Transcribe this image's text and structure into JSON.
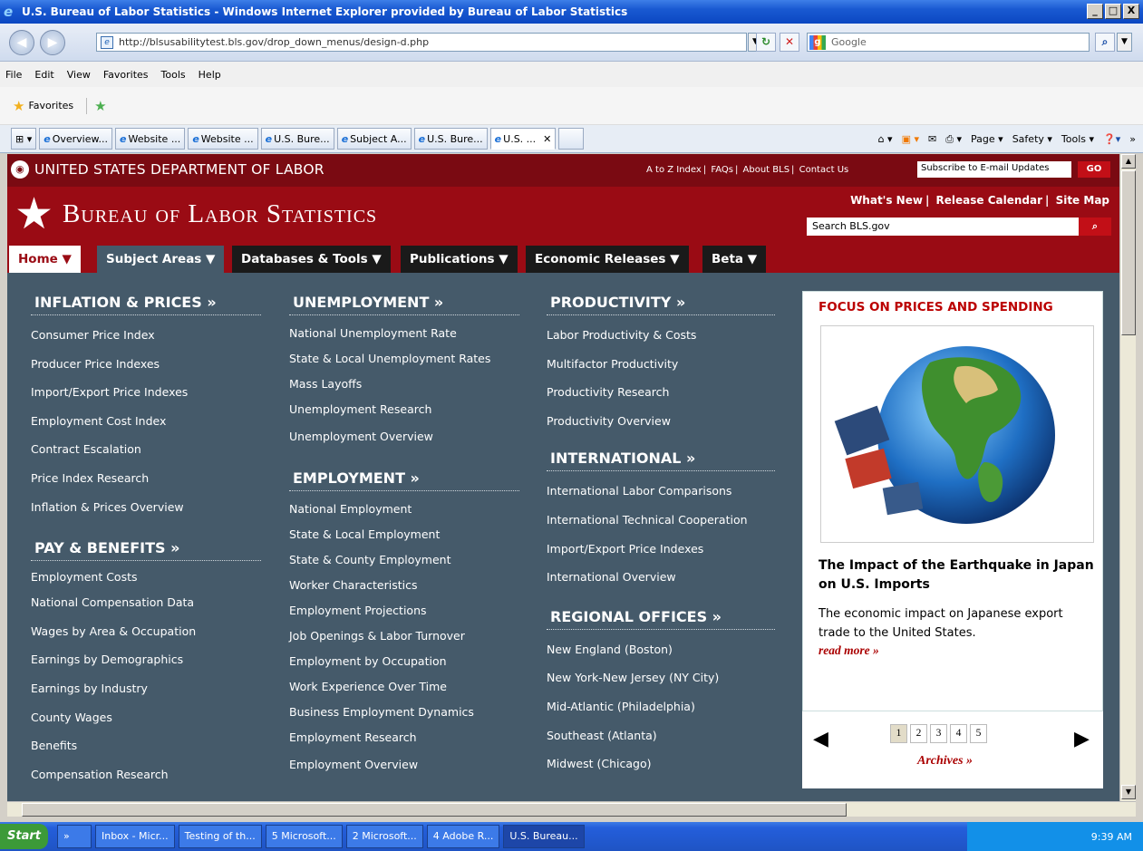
{
  "window": {
    "title": "U.S. Bureau of Labor Statistics - Windows Internet Explorer provided by Bureau of Labor Statistics",
    "min": "_",
    "max": "□",
    "close": "X"
  },
  "address": {
    "url": "http://blsusabilitytest.bls.gov/drop_down_menus/design-d.php",
    "search_placeholder": "Google"
  },
  "menu": [
    "File",
    "Edit",
    "View",
    "Favorites",
    "Tools",
    "Help"
  ],
  "favorites": {
    "label": "Favorites"
  },
  "tabs": [
    "Overview...",
    "Website ...",
    "Website ...",
    "U.S. Bure...",
    "Subject A...",
    "U.S. Bure...",
    "U.S. ..."
  ],
  "commands": {
    "page": "Page ▾",
    "safety": "Safety ▾",
    "tools": "Tools ▾"
  },
  "site": {
    "dol": "UNITED STATES DEPARTMENT OF LABOR",
    "toplinks": [
      "A to Z Index",
      "FAQs",
      "About BLS",
      "Contact Us"
    ],
    "subscribe": "Subscribe to E-mail Updates",
    "go": "GO",
    "bls": "Bureau of Labor Statistics",
    "bls_links": [
      "What's New",
      "Release Calendar",
      "Site Map"
    ],
    "search_value": "Search BLS.gov",
    "search_btn": "Q"
  },
  "nav": [
    {
      "label": "Home ▼"
    },
    {
      "label": "Subject Areas ▼"
    },
    {
      "label": "Databases & Tools ▼"
    },
    {
      "label": "Publications ▼"
    },
    {
      "label": "Economic Releases ▼"
    },
    {
      "label": "Beta ▼"
    }
  ],
  "col1": {
    "s1": "INFLATION & PRICES »",
    "l1": [
      "Consumer Price Index",
      "Producer Price Indexes",
      "Import/Export Price Indexes",
      "Employment Cost Index",
      "Contract Escalation",
      "Price Index Research",
      "Inflation & Prices Overview"
    ],
    "s2": "PAY & BENEFITS »",
    "l2": [
      "Employment Costs",
      "National Compensation Data",
      "Wages by Area & Occupation",
      "Earnings by Demographics",
      "Earnings by Industry",
      "County Wages",
      "Benefits",
      "Compensation Research"
    ]
  },
  "col2": {
    "s1": "UNEMPLOYMENT »",
    "l1": [
      "National Unemployment Rate",
      "State & Local Unemployment Rates",
      "Mass Layoffs",
      "Unemployment Research",
      "Unemployment Overview"
    ],
    "s2": "EMPLOYMENT »",
    "l2": [
      "National Employment",
      "State & Local Employment",
      "State & County Employment",
      "Worker Characteristics",
      "Employment Projections",
      "Job Openings & Labor Turnover",
      "Employment by Occupation",
      "Work Experience Over Time",
      "Business Employment Dynamics",
      "Employment Research",
      "Employment Overview"
    ]
  },
  "col3": {
    "s1": "PRODUCTIVITY »",
    "l1": [
      "Labor Productivity & Costs",
      "Multifactor Productivity",
      "Productivity Research",
      "Productivity Overview"
    ],
    "s2": "INTERNATIONAL »",
    "l2": [
      "International Labor Comparisons",
      "International Technical Cooperation",
      "Import/Export Price Indexes",
      "International Overview"
    ],
    "s3": "REGIONAL OFFICES »",
    "l3": [
      "New England (Boston)",
      "New York-New Jersey (NY City)",
      "Mid-Atlantic (Philadelphia)",
      "Southeast (Atlanta)",
      "Midwest (Chicago)"
    ]
  },
  "focus": {
    "heading": "FOCUS ON PRICES AND SPENDING",
    "title": "The Impact of the Earthquake in Japan on U.S. Imports",
    "desc": "The economic impact on Japanese export trade to the United States.",
    "read_more": "read more »",
    "pages": [
      "1",
      "2",
      "3",
      "4",
      "5"
    ],
    "archives": "Archives »"
  },
  "taskbar": {
    "start": "Start",
    "tasks": [
      "Inbox - Micr...",
      "Testing of th...",
      "5 Microsoft...",
      "2 Microsoft...",
      "4 Adobe R...",
      "U.S. Bureau..."
    ],
    "clock": "9:39 AM"
  },
  "colors": {
    "brand_red": "#9a0b14",
    "dark_red": "#7a0a12",
    "slate": "#455a6a"
  }
}
